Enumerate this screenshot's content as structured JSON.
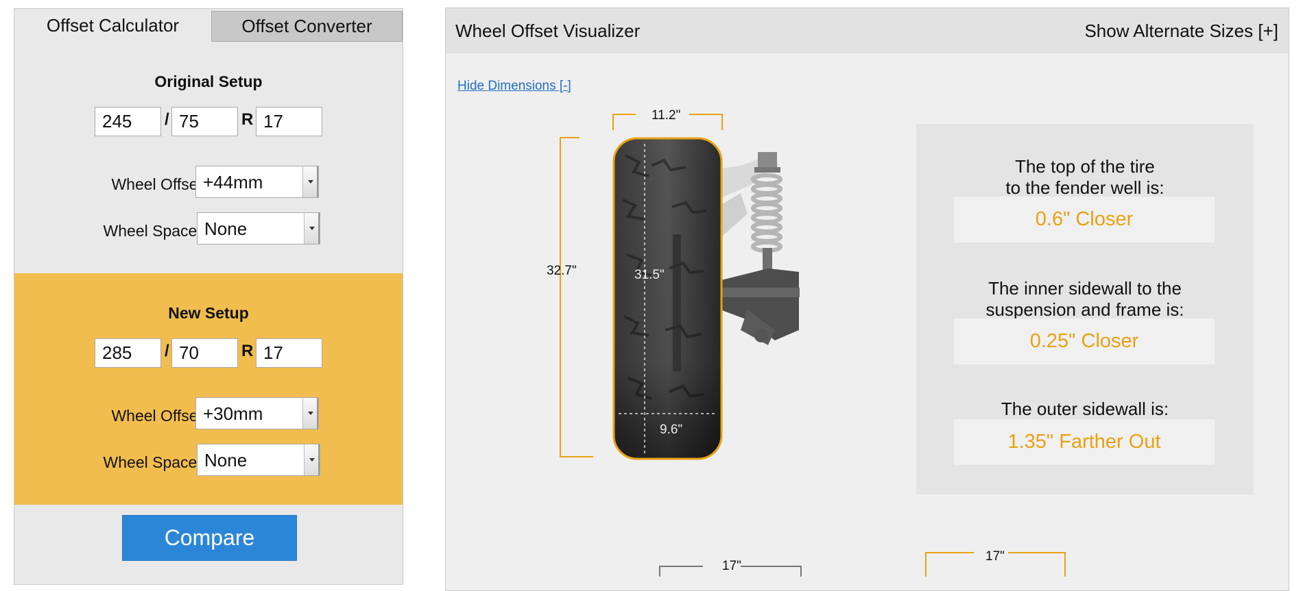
{
  "tabs": {
    "calculator": "Offset Calculator",
    "converter": "Offset Converter"
  },
  "original": {
    "title": "Original Setup",
    "width": "245",
    "aspect": "75",
    "rim": "17",
    "sep_slash": "/",
    "sep_r": "R",
    "offset_label": "Wheel Offset",
    "offset_value": "+44mm",
    "spacer_label": "Wheel Spacer",
    "spacer_value": "None"
  },
  "new_setup": {
    "title": "New Setup",
    "width": "285",
    "aspect": "70",
    "rim": "17",
    "sep_slash": "/",
    "sep_r": "R",
    "offset_label": "Wheel Offset",
    "offset_value": "+30mm",
    "spacer_label": "Wheel Spacer",
    "spacer_value": "None"
  },
  "compare_label": "Compare",
  "visualizer": {
    "title": "Wheel Offset Visualizer",
    "alternate_link": "Show Alternate Sizes [+]",
    "hide_dimensions": "Hide Dimensions [-]",
    "dims": {
      "width": "11.2\"",
      "overall_height": "32.7\"",
      "inner_height": "31.5\"",
      "sidewall": "9.6\"",
      "rim_a": "17\"",
      "rim_b": "17\""
    },
    "results": [
      {
        "question": "The top of the tire\nto the fender well is:",
        "answer": "0.6\" Closer"
      },
      {
        "question": "The inner sidewall to the\nsuspension and frame is:",
        "answer": "0.25\" Closer"
      },
      {
        "question": "The outer sidewall is:",
        "answer": "1.35\" Farther Out"
      }
    ]
  },
  "colors": {
    "accent": "#f2bd4f",
    "answer": "#e9a112",
    "button": "#2c86d8",
    "link": "#2370c2"
  }
}
